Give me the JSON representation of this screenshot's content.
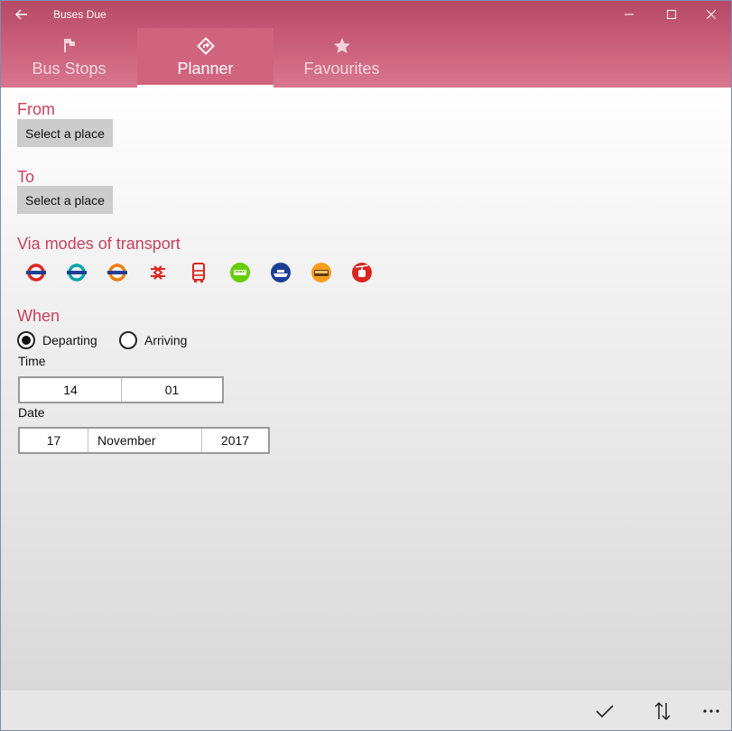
{
  "window": {
    "title": "Buses Due"
  },
  "tabs": [
    {
      "label": "Bus Stops",
      "icon": "flag-icon"
    },
    {
      "label": "Planner",
      "icon": "directions-icon"
    },
    {
      "label": "Favourites",
      "icon": "star-icon"
    }
  ],
  "planner": {
    "from_label": "From",
    "from_button": "Select a place",
    "to_label": "To",
    "to_button": "Select a place",
    "via_label": "Via modes of transport",
    "modes": [
      {
        "icon": "underground-roundel-icon",
        "color": "#dc241f"
      },
      {
        "icon": "overground-roundel-icon",
        "color": "#00a4a7"
      },
      {
        "icon": "tfl-rail-roundel-icon",
        "color": "#ee7c0e"
      },
      {
        "icon": "national-rail-icon",
        "color": "#dc241f"
      },
      {
        "icon": "bus-icon",
        "color": "#dc241f"
      },
      {
        "icon": "tram-icon",
        "color": "#66cc00"
      },
      {
        "icon": "river-boat-icon",
        "color": "#1c3f94"
      },
      {
        "icon": "coach-icon",
        "color": "#f99d1c"
      },
      {
        "icon": "cable-car-icon",
        "color": "#dc241f"
      }
    ],
    "when_label": "When",
    "departing_label": "Departing",
    "arriving_label": "Arriving",
    "selected_option": "Departing",
    "time_label": "Time",
    "time": {
      "hour": "14",
      "minute": "01"
    },
    "date_label": "Date",
    "date": {
      "day": "17",
      "month": "November",
      "year": "2017"
    }
  },
  "colors": {
    "accent": "#c8415f",
    "header": "#c85b77"
  }
}
